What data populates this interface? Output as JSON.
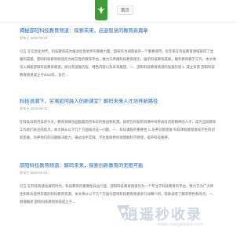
{
  "header": {
    "nav_home": "首页"
  },
  "articles": [
    {
      "title": "揭秘邵阳科技教育频道：探索未来，启迪智慧的教育新篇章",
      "date": "发布于 2025-06-03",
      "summary": "引言 在信息化时代，科技教育成为推动社会进步的重要力量，邵阳作为湖南省的一个重要城市，近年来在科技教育领域取得了显著的成绩。邵阳科技教育频道作为地方性的教育平台，致力于传播科技教育理念，展示科技教育成果，服务教育教学工作，本文将深入揭秘邵阳科技教育频道，探讨其发展历程、特色内容以及未来展望。一、邵阳科技教育频道的发展历程 1. 成立背景 邵阳科技教育频道成立于2010年，旨在..."
    },
    {
      "title": "科技浪潮下，穷离如何融入创新课堂？解码未来人才培养新路径",
      "date": "发布于 2025-06-03",
      "summary": "在科技日新月异的今天，教育领域也面临着前所未有的挑战和机遇。如何在科技的浪潮中培养具有创新精神的人才，成为当前教育工作者们关注的焦点。本文将从以下几个方面探讨这一问题。一、科技课程的重要性 1. 培养创新思维 科技课程能够激发学生的创新思维，培养他们的问题解决能力。通过动手实践，学生能够更好地理解科学原理，提升科技素养。"
    },
    {
      "title": "邵阳科技教育频道：解码未来，探索创新教育的无限可能",
      "date": "发布于 2025-06-03",
      "summary": "引言 在科技快速发展的时代，科技教育的重要性日益凸显。邵阳科技教育频道作为一个专注于科技教育的平台，致力于为广大师生和家长提供丰富的科技教育资源，本文将从以下几个方面对邵阳科技教育频道进行详细介绍，帮助读者了解其特色和亮点。一、频道概述 邵阳科技教育频道成立于..."
    }
  ],
  "watermark": {
    "main": "逍遥秒收录",
    "sub": "www.xiaoyaoseo.com"
  }
}
